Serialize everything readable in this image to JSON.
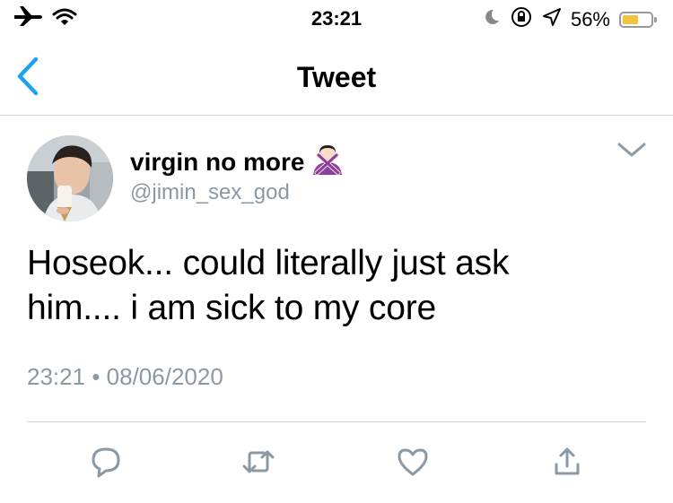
{
  "status_bar": {
    "time": "23:21",
    "battery_percent": "56%",
    "battery_level": 0.56,
    "icons": [
      "airplane-icon",
      "wifi-icon",
      "moon-icon",
      "orientation-lock-icon",
      "location-icon",
      "battery-icon"
    ]
  },
  "nav": {
    "title": "Tweet",
    "back_icon": "chevron-left-icon"
  },
  "tweet": {
    "display_name": "virgin no more",
    "emoji": "🙅🏻‍♀️",
    "handle": "@jimin_sex_god",
    "text_line1": "Hoseok... could literally just ask",
    "text_line2": "him.... i am sick to my core",
    "time": "23:21",
    "separator": "•",
    "date": "08/06/2020"
  },
  "actions": [
    "reply-icon",
    "retweet-icon",
    "like-icon",
    "share-icon"
  ],
  "colors": {
    "accent": "#1da1f2",
    "secondary_text": "#8b98a5",
    "divider": "#d3d6d9",
    "battery": "#f4c23b"
  }
}
